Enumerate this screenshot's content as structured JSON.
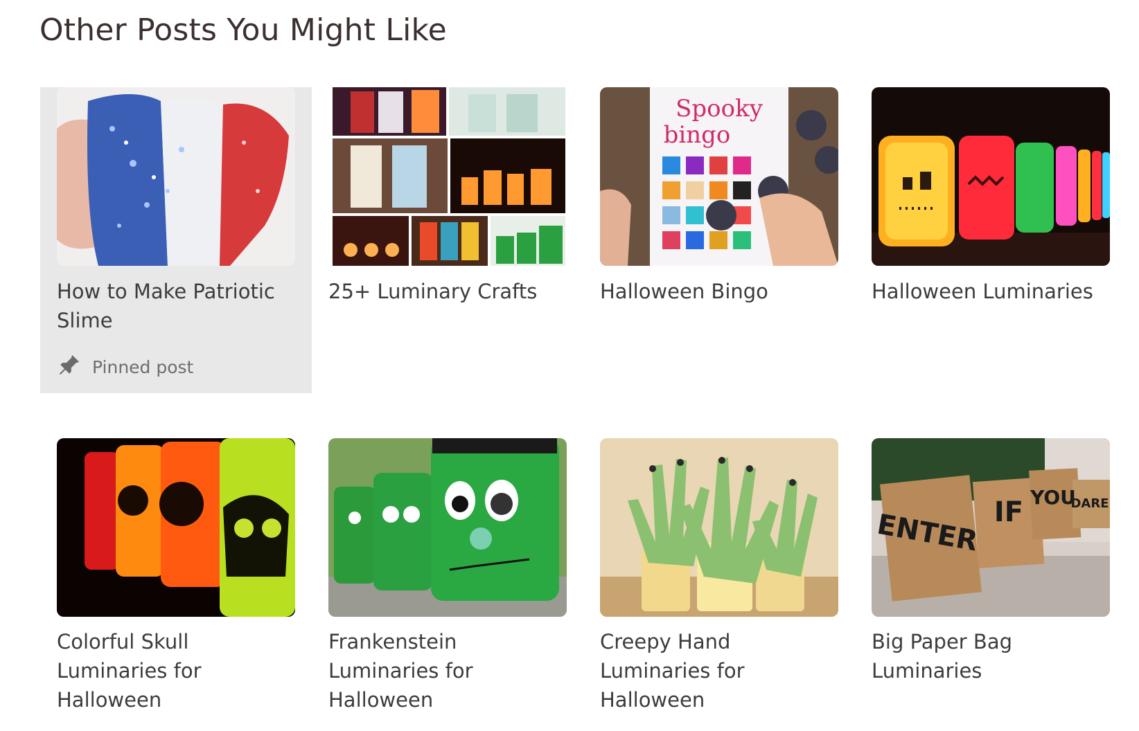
{
  "heading": "Other Posts You Might Like",
  "posts": [
    {
      "title": "How to Make Patriotic Slime",
      "image_icon": "patriotic-slime-photo",
      "pinned": true,
      "pinned_label": "Pinned post"
    },
    {
      "title": "25+ Luminary Crafts",
      "image_icon": "luminary-collage-photo"
    },
    {
      "title": "Halloween Bingo",
      "image_icon": "spooky-bingo-photo",
      "image_text": "Spooky bingo"
    },
    {
      "title": "Halloween Luminaries",
      "image_icon": "jack-o-lantern-jars-photo"
    },
    {
      "title": "Colorful Skull Luminaries for Halloween",
      "image_icon": "skull-jars-photo"
    },
    {
      "title": "Frankenstein Luminaries for Halloween",
      "image_icon": "frankenstein-jars-photo"
    },
    {
      "title": "Creepy Hand Luminaries for Halloween",
      "image_icon": "creepy-hands-photo"
    },
    {
      "title": "Big Paper Bag Luminaries",
      "image_icon": "paper-bag-photo",
      "image_text": [
        "ENTER",
        "IF",
        "YOU",
        "DARE"
      ]
    }
  ],
  "colors": {
    "heading": "#3b2f2f",
    "pinned_bg": "#e8e8e8",
    "text": "#3c3c3c"
  }
}
